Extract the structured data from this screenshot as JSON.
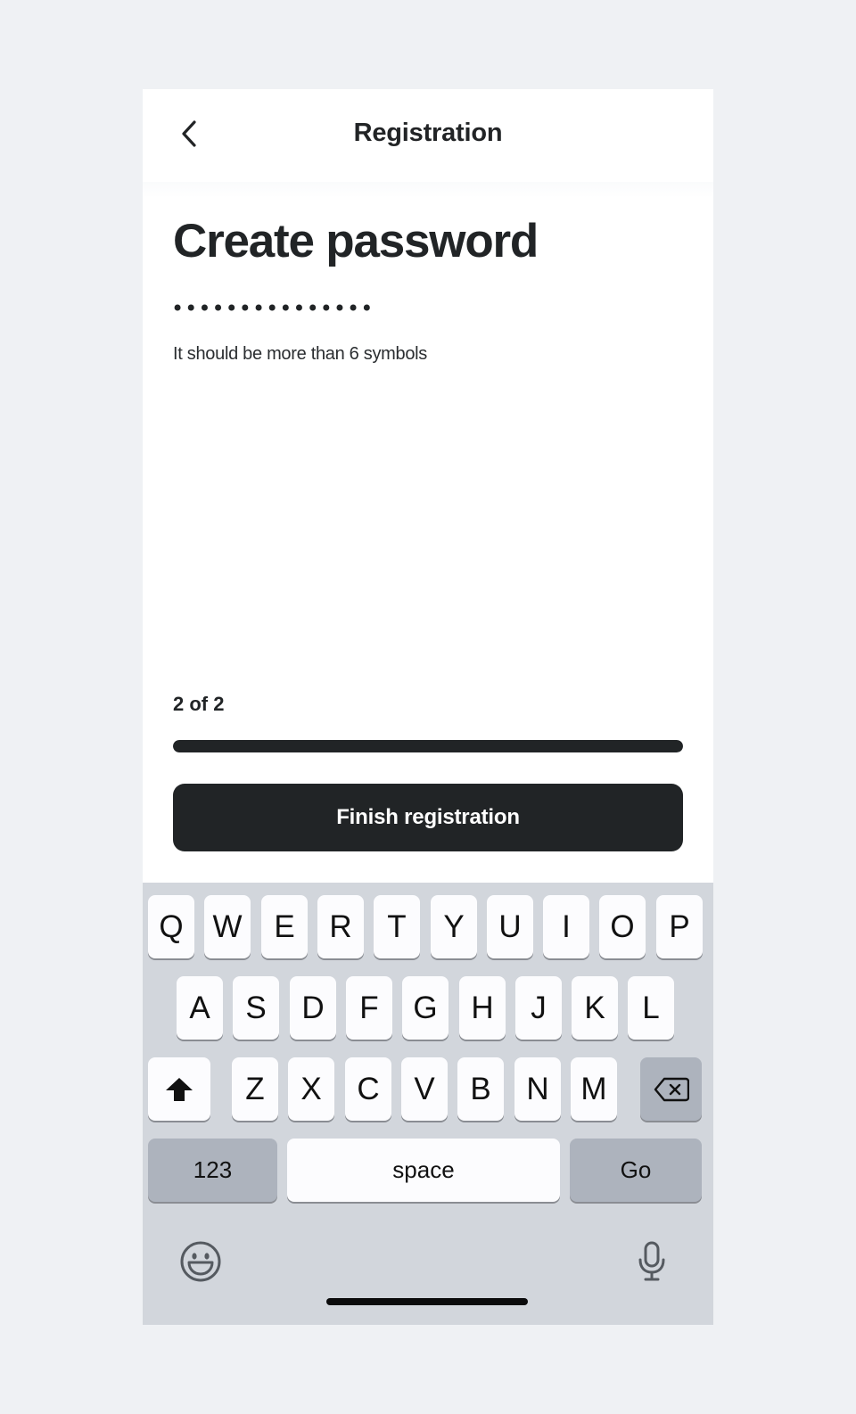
{
  "header": {
    "title": "Registration",
    "back_icon": "chevron-left-icon"
  },
  "main": {
    "title": "Create password",
    "password_value": "qwertyuiopasdf1",
    "hint": "It should be more than 6 symbols",
    "step_label": "2 of 2",
    "progress": 1.0,
    "finish_label": "Finish registration"
  },
  "keyboard": {
    "row1": [
      "Q",
      "W",
      "E",
      "R",
      "T",
      "Y",
      "U",
      "I",
      "O",
      "P"
    ],
    "row2": [
      "A",
      "S",
      "D",
      "F",
      "G",
      "H",
      "J",
      "K",
      "L"
    ],
    "row3": [
      "Z",
      "X",
      "C",
      "V",
      "B",
      "N",
      "M"
    ],
    "shift_icon": "shift-icon",
    "delete_icon": "backspace-icon",
    "numbers_label": "123",
    "space_label": "space",
    "go_label": "Go",
    "emoji_icon": "emoji-icon",
    "mic_icon": "microphone-icon"
  },
  "colors": {
    "primary": "#212426",
    "background": "#eff1f4",
    "keyboard_bg": "#d2d6dc",
    "key_dark": "#adb3bd"
  }
}
